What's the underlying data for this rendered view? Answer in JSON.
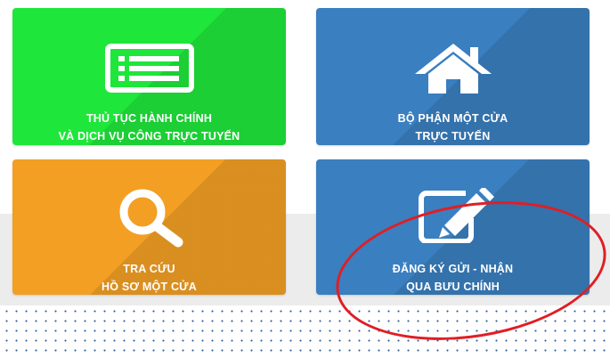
{
  "colors": {
    "green": "#1ee63a",
    "blue": "#3a7fbf",
    "orange": "#f29f24",
    "annotation_red": "#e01e24"
  },
  "tiles": [
    {
      "line1": "THỦ TỤC HÀNH CHÍNH",
      "line2": "VÀ DỊCH VỤ CÔNG TRỰC TUYẾN",
      "icon": "list-card-icon"
    },
    {
      "line1": "BỘ PHẬN MỘT CỬA",
      "line2": "TRỰC TUYẾN",
      "icon": "home-icon"
    },
    {
      "line1": "TRA CỨU",
      "line2": "HỒ SƠ MỘT CỬA",
      "icon": "search-icon"
    },
    {
      "line1": "ĐĂNG KÝ GỬI - NHẬN",
      "line2": "QUA BƯU CHÍNH",
      "icon": "edit-pencil-icon"
    }
  ]
}
